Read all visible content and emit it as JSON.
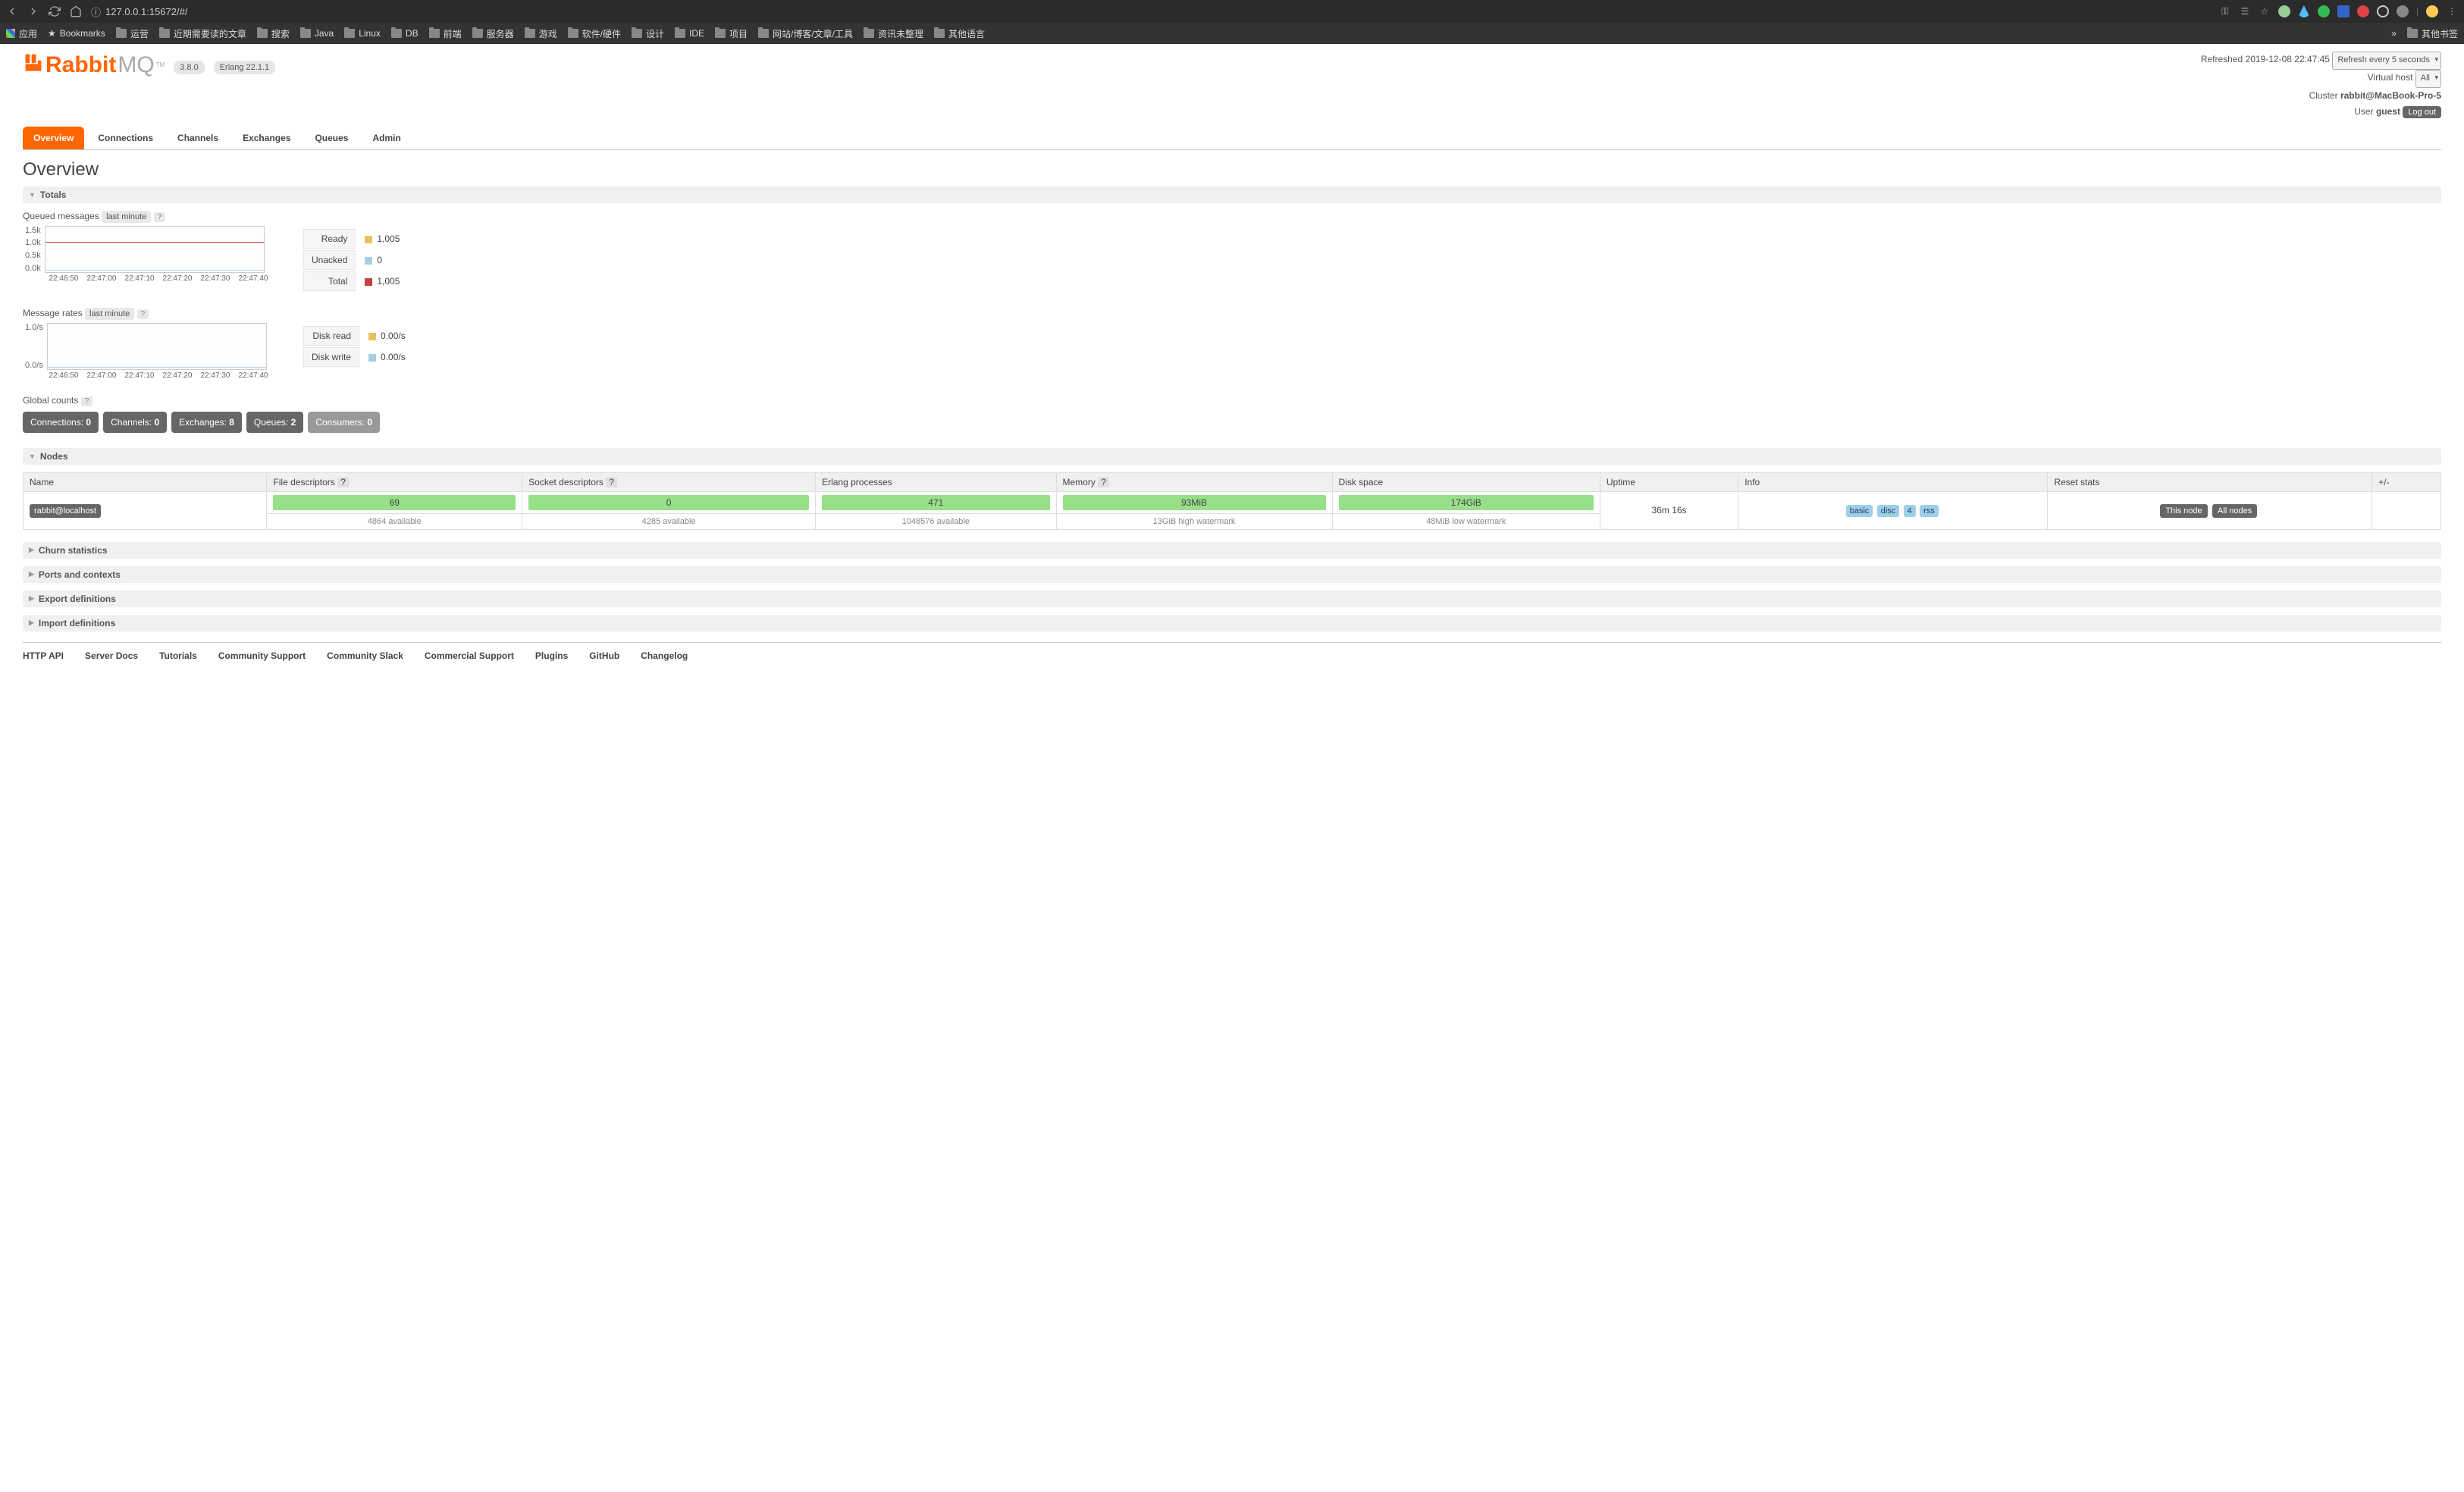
{
  "browser": {
    "url_protocol_icon": "ⓘ",
    "url": "127.0.0.1:15672/#/",
    "bookmarks": [
      "应用",
      "Bookmarks",
      "运营",
      "近期需要读的文章",
      "搜索",
      "Java",
      "Linux",
      "DB",
      "前端",
      "服务器",
      "游戏",
      "软件/硬件",
      "设计",
      "IDE",
      "项目",
      "网站/博客/文章/工具",
      "资讯未整理",
      "其他语言"
    ],
    "bookmark_overflow": "»",
    "bookmark_right": "其他书签"
  },
  "header": {
    "logo_r": "Rabbit",
    "logo_mq": "MQ",
    "logo_tm": "TM",
    "version": "3.8.0",
    "erlang": "Erlang 22.1.1",
    "refreshed_label": "Refreshed",
    "refreshed_time": "2019-12-08 22:47:45",
    "refresh_select": "Refresh every 5 seconds",
    "vhost_label": "Virtual host",
    "vhost_select": "All",
    "cluster_label": "Cluster",
    "cluster_name": "rabbit@MacBook-Pro-5",
    "user_label": "User",
    "user_name": "guest",
    "logout": "Log out"
  },
  "tabs": [
    "Overview",
    "Connections",
    "Channels",
    "Exchanges",
    "Queues",
    "Admin"
  ],
  "page_title": "Overview",
  "sections": {
    "totals": "Totals",
    "nodes": "Nodes",
    "churn": "Churn statistics",
    "ports": "Ports and contexts",
    "export": "Export definitions",
    "import": "Import definitions"
  },
  "queued": {
    "title": "Queued messages",
    "tag": "last minute",
    "help": "?",
    "y": [
      "1.5k",
      "1.0k",
      "0.5k",
      "0.0k"
    ],
    "x": [
      "22:46:50",
      "22:47:00",
      "22:47:10",
      "22:47:20",
      "22:47:30",
      "22:47:40"
    ],
    "legend": [
      {
        "label": "Ready",
        "color": "#e8c260",
        "value": "1,005"
      },
      {
        "label": "Unacked",
        "color": "#a6cee3",
        "value": "0"
      },
      {
        "label": "Total",
        "color": "#c94040",
        "value": "1,005"
      }
    ]
  },
  "rates": {
    "title": "Message rates",
    "tag": "last minute",
    "help": "?",
    "y": [
      "1.0/s",
      "0.0/s"
    ],
    "x": [
      "22:46:50",
      "22:47:00",
      "22:47:10",
      "22:47:20",
      "22:47:30",
      "22:47:40"
    ],
    "legend": [
      {
        "label": "Disk read",
        "color": "#e8c260",
        "value": "0.00/s"
      },
      {
        "label": "Disk write",
        "color": "#a6cee3",
        "value": "0.00/s"
      }
    ]
  },
  "global": {
    "title": "Global counts",
    "help": "?",
    "counts": [
      {
        "label": "Connections:",
        "value": "0"
      },
      {
        "label": "Channels:",
        "value": "0"
      },
      {
        "label": "Exchanges:",
        "value": "8"
      },
      {
        "label": "Queues:",
        "value": "2"
      },
      {
        "label": "Consumers:",
        "value": "0",
        "muted": true
      }
    ]
  },
  "nodes_table": {
    "headers": [
      "Name",
      "File descriptors",
      "Socket descriptors",
      "Erlang processes",
      "Memory",
      "Disk space",
      "Uptime",
      "Info",
      "Reset stats",
      "+/-"
    ],
    "help": "?",
    "row": {
      "name": "rabbit@localhost",
      "fd": "69",
      "fd_sub": "4864 available",
      "sd": "0",
      "sd_sub": "4285 available",
      "ep": "471",
      "ep_sub": "1048576 available",
      "mem": "93MiB",
      "mem_sub": "13GiB high watermark",
      "disk": "174GiB",
      "disk_sub": "48MiB low watermark",
      "uptime": "36m 16s",
      "info": [
        "basic",
        "disc",
        "4",
        "rss"
      ],
      "reset": [
        "This node",
        "All nodes"
      ]
    }
  },
  "footer": [
    "HTTP API",
    "Server Docs",
    "Tutorials",
    "Community Support",
    "Community Slack",
    "Commercial Support",
    "Plugins",
    "GitHub",
    "Changelog"
  ],
  "chart_data": [
    {
      "type": "line",
      "title": "Queued messages (last minute)",
      "x": [
        "22:46:50",
        "22:47:00",
        "22:47:10",
        "22:47:20",
        "22:47:30",
        "22:47:40"
      ],
      "series": [
        {
          "name": "Ready",
          "values": [
            1005,
            1005,
            1005,
            1005,
            1005,
            1005
          ]
        },
        {
          "name": "Unacked",
          "values": [
            0,
            0,
            0,
            0,
            0,
            0
          ]
        },
        {
          "name": "Total",
          "values": [
            1005,
            1005,
            1005,
            1005,
            1005,
            1005
          ]
        }
      ],
      "ylim": [
        0,
        1500
      ]
    },
    {
      "type": "line",
      "title": "Message rates (last minute)",
      "x": [
        "22:46:50",
        "22:47:00",
        "22:47:10",
        "22:47:20",
        "22:47:30",
        "22:47:40"
      ],
      "series": [
        {
          "name": "Disk read",
          "values": [
            0,
            0,
            0,
            0,
            0,
            0
          ]
        },
        {
          "name": "Disk write",
          "values": [
            0,
            0,
            0,
            0,
            0,
            0
          ]
        }
      ],
      "ylim": [
        0,
        1
      ]
    }
  ]
}
